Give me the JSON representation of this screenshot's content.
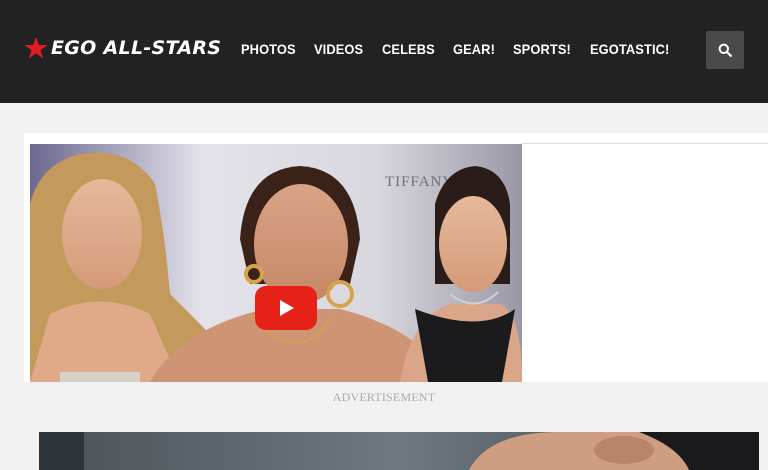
{
  "header": {
    "logo_text": "EGO ALL-STARS",
    "nav": [
      {
        "label": "PHOTOS"
      },
      {
        "label": "VIDEOS"
      },
      {
        "label": "CELEBS"
      },
      {
        "label": "GEAR!"
      },
      {
        "label": "SPORTS!"
      },
      {
        "label": "EGOTASTIC!"
      }
    ],
    "search_icon": "search-icon"
  },
  "video": {
    "backdrop_text": "TIFFANY",
    "play_icon": "play-icon"
  },
  "ad_label": "ADVERTISEMENT",
  "colors": {
    "header_bg": "#222222",
    "logo_star": "#e11b22",
    "page_bg": "#f1f1f1",
    "play_button": "#e62117"
  }
}
